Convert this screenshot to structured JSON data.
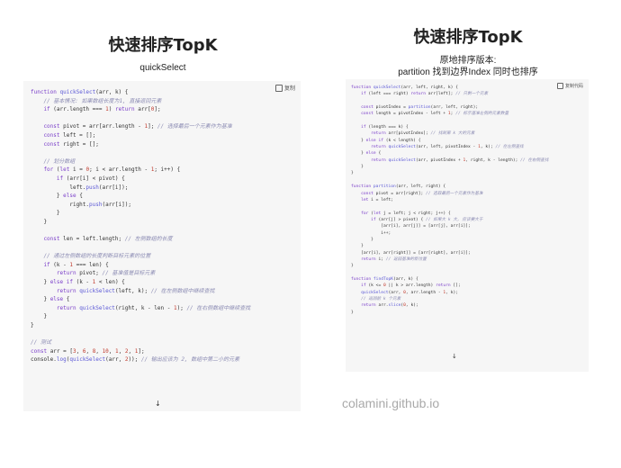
{
  "left": {
    "title": "快速排序TopK",
    "subtitle": "quickSelect",
    "copy_label": "复制",
    "code": [
      [
        [
          "kw",
          "function "
        ],
        [
          "fn",
          "quickSelect"
        ],
        [
          "pl",
          "(arr, k) {"
        ]
      ],
      [
        [
          "cm",
          "    // 基本情况: 如果数组长度为1, 直接返回元素"
        ]
      ],
      [
        [
          "kw",
          "    if "
        ],
        [
          "pl",
          "(arr.length === "
        ],
        [
          "num",
          "1"
        ],
        [
          "pl",
          ") "
        ],
        [
          "kw",
          "return "
        ],
        [
          "pl",
          "arr["
        ],
        [
          "num",
          "0"
        ],
        [
          "pl",
          "];"
        ]
      ],
      [
        [
          "pl",
          ""
        ]
      ],
      [
        [
          "kw",
          "    const "
        ],
        [
          "pl",
          "pivot = arr[arr.length - "
        ],
        [
          "num",
          "1"
        ],
        [
          "pl",
          "]; "
        ],
        [
          "cm",
          "// 选择最后一个元素作为基准"
        ]
      ],
      [
        [
          "kw",
          "    const "
        ],
        [
          "pl",
          "left = [];"
        ]
      ],
      [
        [
          "kw",
          "    const "
        ],
        [
          "pl",
          "right = [];"
        ]
      ],
      [
        [
          "pl",
          ""
        ]
      ],
      [
        [
          "cm",
          "    // 划分数组"
        ]
      ],
      [
        [
          "kw",
          "    for "
        ],
        [
          "pl",
          "("
        ],
        [
          "kw",
          "let "
        ],
        [
          "pl",
          "i = "
        ],
        [
          "num",
          "0"
        ],
        [
          "pl",
          "; i < arr.length - "
        ],
        [
          "num",
          "1"
        ],
        [
          "pl",
          "; i++) {"
        ]
      ],
      [
        [
          "kw",
          "        if "
        ],
        [
          "pl",
          "(arr[i] < pivot) {"
        ]
      ],
      [
        [
          "pl",
          "            left."
        ],
        [
          "fn",
          "push"
        ],
        [
          "pl",
          "(arr[i]);"
        ]
      ],
      [
        [
          "pl",
          "        } "
        ],
        [
          "kw",
          "else "
        ],
        [
          "pl",
          "{"
        ]
      ],
      [
        [
          "pl",
          "            right."
        ],
        [
          "fn",
          "push"
        ],
        [
          "pl",
          "(arr[i]);"
        ]
      ],
      [
        [
          "pl",
          "        }"
        ]
      ],
      [
        [
          "pl",
          "    }"
        ]
      ],
      [
        [
          "pl",
          ""
        ]
      ],
      [
        [
          "kw",
          "    const "
        ],
        [
          "pl",
          "len = left.length; "
        ],
        [
          "cm",
          "// 左侧数组的长度"
        ]
      ],
      [
        [
          "pl",
          ""
        ]
      ],
      [
        [
          "cm",
          "    // 通过左侧数组的长度判断目标元素的位置"
        ]
      ],
      [
        [
          "kw",
          "    if "
        ],
        [
          "pl",
          "(k - "
        ],
        [
          "num",
          "1"
        ],
        [
          "pl",
          " === len) {"
        ]
      ],
      [
        [
          "kw",
          "        return "
        ],
        [
          "pl",
          "pivot; "
        ],
        [
          "cm",
          "// 基准值是目标元素"
        ]
      ],
      [
        [
          "pl",
          "    } "
        ],
        [
          "kw",
          "else if "
        ],
        [
          "pl",
          "(k - "
        ],
        [
          "num",
          "1"
        ],
        [
          "pl",
          " < len) {"
        ]
      ],
      [
        [
          "kw",
          "        return "
        ],
        [
          "fn",
          "quickSelect"
        ],
        [
          "pl",
          "(left, k); "
        ],
        [
          "cm",
          "// 在左侧数组中继续查找"
        ]
      ],
      [
        [
          "pl",
          "    } "
        ],
        [
          "kw",
          "else "
        ],
        [
          "pl",
          "{"
        ]
      ],
      [
        [
          "kw",
          "        return "
        ],
        [
          "fn",
          "quickSelect"
        ],
        [
          "pl",
          "(right, k - len - "
        ],
        [
          "num",
          "1"
        ],
        [
          "pl",
          "); "
        ],
        [
          "cm",
          "// 在右侧数组中继续查找"
        ]
      ],
      [
        [
          "pl",
          "    }"
        ]
      ],
      [
        [
          "pl",
          "}"
        ]
      ],
      [
        [
          "pl",
          ""
        ]
      ],
      [
        [
          "cm",
          "// 测试"
        ]
      ],
      [
        [
          "kw",
          "const "
        ],
        [
          "pl",
          "arr = ["
        ],
        [
          "num",
          "3"
        ],
        [
          "pl",
          ", "
        ],
        [
          "num",
          "6"
        ],
        [
          "pl",
          ", "
        ],
        [
          "num",
          "8"
        ],
        [
          "pl",
          ", "
        ],
        [
          "num",
          "10"
        ],
        [
          "pl",
          ", "
        ],
        [
          "num",
          "1"
        ],
        [
          "pl",
          ", "
        ],
        [
          "num",
          "2"
        ],
        [
          "pl",
          ", "
        ],
        [
          "num",
          "1"
        ],
        [
          "pl",
          "];"
        ]
      ],
      [
        [
          "pl",
          "console."
        ],
        [
          "fn",
          "log"
        ],
        [
          "pl",
          "("
        ],
        [
          "fn",
          "quickSelect"
        ],
        [
          "pl",
          "(arr, "
        ],
        [
          "num",
          "2"
        ],
        [
          "pl",
          ")); "
        ],
        [
          "cm",
          "// 输出应该为 2, 数组中第二小的元素"
        ]
      ]
    ]
  },
  "right": {
    "title": "快速排序TopK",
    "subtitle_line1": "原地排序版本:",
    "subtitle_line2": "partition 找到边界Index 同时也排序",
    "copy_label": "复制代码",
    "code": [
      [
        [
          "kw",
          "function "
        ],
        [
          "fn",
          "quickSelect"
        ],
        [
          "pl",
          "(arr, left, right, k) {"
        ]
      ],
      [
        [
          "kw",
          "    if "
        ],
        [
          "pl",
          "(left === right) "
        ],
        [
          "kw",
          "return "
        ],
        [
          "pl",
          "arr[left]; "
        ],
        [
          "cm",
          "// 只剩一个元素"
        ]
      ],
      [
        [
          "pl",
          ""
        ]
      ],
      [
        [
          "kw",
          "    const "
        ],
        [
          "pl",
          "pivotIndex = "
        ],
        [
          "fn",
          "partition"
        ],
        [
          "pl",
          "(arr, left, right);"
        ]
      ],
      [
        [
          "kw",
          "    const "
        ],
        [
          "pl",
          "length = pivotIndex - left + "
        ],
        [
          "num",
          "1"
        ],
        [
          "pl",
          "; "
        ],
        [
          "cm",
          "// 标示基准左侧的元素数量"
        ]
      ],
      [
        [
          "pl",
          ""
        ]
      ],
      [
        [
          "kw",
          "    if "
        ],
        [
          "pl",
          "(length === k) {"
        ]
      ],
      [
        [
          "kw",
          "        return "
        ],
        [
          "pl",
          "arr[pivotIndex]; "
        ],
        [
          "cm",
          "// 找到第 k 大的元素"
        ]
      ],
      [
        [
          "pl",
          "    } "
        ],
        [
          "kw",
          "else if "
        ],
        [
          "pl",
          "(k < length) {"
        ]
      ],
      [
        [
          "kw",
          "        return "
        ],
        [
          "fn",
          "quickSelect"
        ],
        [
          "pl",
          "(arr, left, pivotIndex - "
        ],
        [
          "num",
          "1"
        ],
        [
          "pl",
          ", k); "
        ],
        [
          "cm",
          "// 在左侧查找"
        ]
      ],
      [
        [
          "pl",
          "    } "
        ],
        [
          "kw",
          "else "
        ],
        [
          "pl",
          "{"
        ]
      ],
      [
        [
          "kw",
          "        return "
        ],
        [
          "fn",
          "quickSelect"
        ],
        [
          "pl",
          "(arr, pivotIndex + "
        ],
        [
          "num",
          "1"
        ],
        [
          "pl",
          ", right, k - length); "
        ],
        [
          "cm",
          "// 在右侧查找"
        ]
      ],
      [
        [
          "pl",
          "    }"
        ]
      ],
      [
        [
          "pl",
          "}"
        ]
      ],
      [
        [
          "pl",
          ""
        ]
      ],
      [
        [
          "kw",
          "function "
        ],
        [
          "fn",
          "partition"
        ],
        [
          "pl",
          "(arr, left, right) {"
        ]
      ],
      [
        [
          "kw",
          "    const "
        ],
        [
          "pl",
          "pivot = arr[right]; "
        ],
        [
          "cm",
          "// 选取最后一个元素作为基准"
        ]
      ],
      [
        [
          "kw",
          "    let "
        ],
        [
          "pl",
          "i = left;"
        ]
      ],
      [
        [
          "pl",
          ""
        ]
      ],
      [
        [
          "kw",
          "    for "
        ],
        [
          "pl",
          "("
        ],
        [
          "kw",
          "let "
        ],
        [
          "pl",
          "j = left; j < right; j++) {"
        ]
      ],
      [
        [
          "kw",
          "        if "
        ],
        [
          "pl",
          "(arr[j] > pivot) { "
        ],
        [
          "cm",
          "// 如果大 k 大, 应该要大于"
        ]
      ],
      [
        [
          "pl",
          "            [arr[i], arr[j]] = [arr[j], arr[i]];"
        ]
      ],
      [
        [
          "pl",
          "            i++;"
        ]
      ],
      [
        [
          "pl",
          "        }"
        ]
      ],
      [
        [
          "pl",
          "    }"
        ]
      ],
      [
        [
          "pl",
          "    [arr[i], arr[right]] = [arr[right], arr[i]];"
        ]
      ],
      [
        [
          "kw",
          "    return "
        ],
        [
          "pl",
          "i; "
        ],
        [
          "cm",
          "// 返回基准的新位置"
        ]
      ],
      [
        [
          "pl",
          "}"
        ]
      ],
      [
        [
          "pl",
          ""
        ]
      ],
      [
        [
          "kw",
          "function "
        ],
        [
          "fn",
          "findTopK"
        ],
        [
          "pl",
          "(arr, k) {"
        ]
      ],
      [
        [
          "kw",
          "    if "
        ],
        [
          "pl",
          "(k <= "
        ],
        [
          "num",
          "0"
        ],
        [
          "pl",
          " || k > arr.length) "
        ],
        [
          "kw",
          "return "
        ],
        [
          "pl",
          "[];"
        ]
      ],
      [
        [
          "pl",
          "    "
        ],
        [
          "fn",
          "quickSelect"
        ],
        [
          "pl",
          "(arr, "
        ],
        [
          "num",
          "0"
        ],
        [
          "pl",
          ", arr.length - "
        ],
        [
          "num",
          "1"
        ],
        [
          "pl",
          ", k);"
        ]
      ],
      [
        [
          "cm",
          "    // 返回前 k 个元素"
        ]
      ],
      [
        [
          "kw",
          "    return "
        ],
        [
          "pl",
          "arr."
        ],
        [
          "fn",
          "slice"
        ],
        [
          "pl",
          "("
        ],
        [
          "num",
          "0"
        ],
        [
          "pl",
          ", k);"
        ]
      ],
      [
        [
          "pl",
          "}"
        ]
      ]
    ]
  },
  "footer": "colamini.github.io"
}
